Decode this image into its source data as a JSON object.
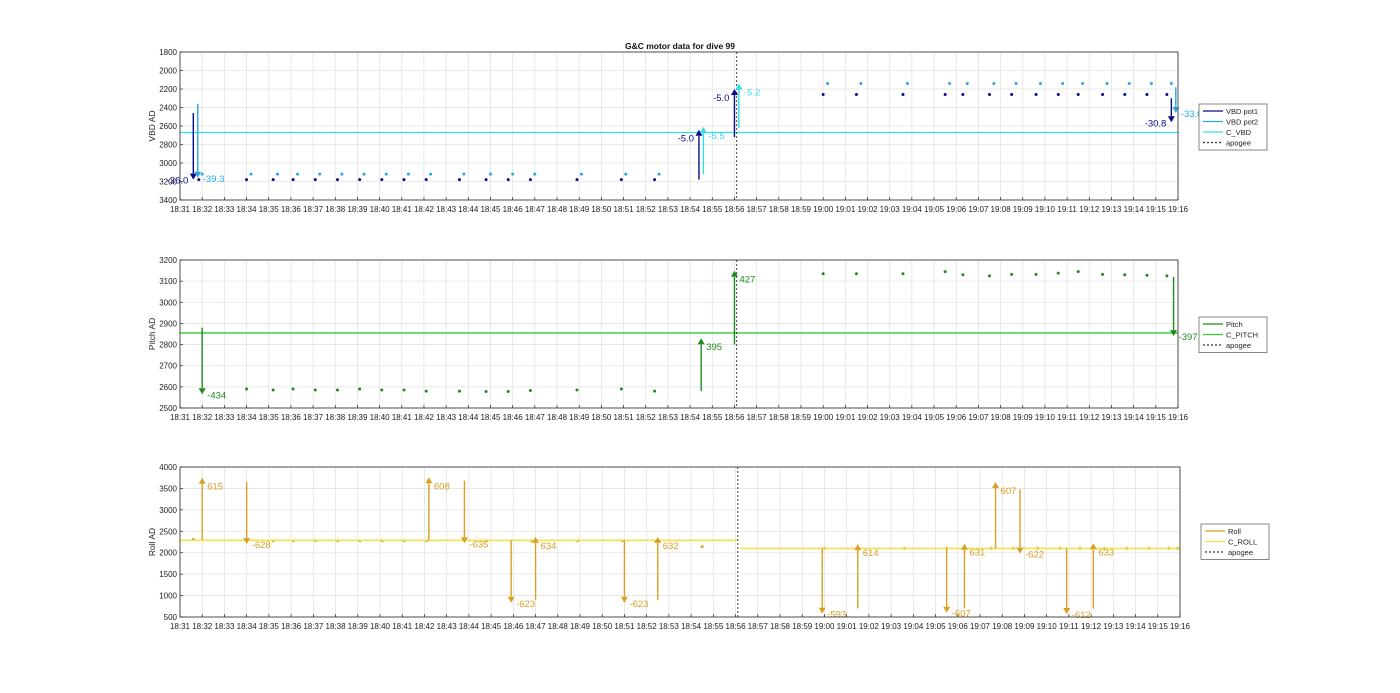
{
  "figure": {
    "title": "G&C motor data for dive 99"
  },
  "time_ticks": [
    "18:31",
    "18:32",
    "18:33",
    "18:34",
    "18:35",
    "18:36",
    "18:37",
    "18:38",
    "18:39",
    "18:40",
    "18:41",
    "18:42",
    "18:43",
    "18:44",
    "18:45",
    "18:46",
    "18:47",
    "18:48",
    "18:49",
    "18:50",
    "18:51",
    "18:52",
    "18:53",
    "18:54",
    "18:55",
    "18:56",
    "18:57",
    "18:58",
    "18:59",
    "19:00",
    "19:01",
    "19:02",
    "19:03",
    "19:04",
    "19:05",
    "19:06",
    "19:07",
    "19:08",
    "19:09",
    "19:10",
    "19:11",
    "19:12",
    "19:13",
    "19:14",
    "19:15",
    "19:16"
  ],
  "colors": {
    "vbd1": "#0a0a8c",
    "vbd2": "#2aa8e0",
    "c_vbd": "#33dde8",
    "pitch": "#1f8a1f",
    "c_pitch": "#33cc33",
    "roll": "#d9a024",
    "c_roll": "#f2e34a",
    "apogee": "#333333",
    "grid": "#e3e3e3",
    "axis": "#262626"
  },
  "chart_data": [
    {
      "type": "line",
      "title": "G&C motor data for dive 99",
      "xlabel": "",
      "ylabel": "VBD AD",
      "xlim": [
        "18:31",
        "19:16"
      ],
      "ylim": [
        3400,
        1800
      ],
      "y_reversed": true,
      "yticks": [
        1800,
        2000,
        2200,
        2400,
        2600,
        2800,
        3000,
        3200,
        3400
      ],
      "grid": true,
      "legend_location": "right",
      "series": [
        {
          "name": "VBD pot1",
          "key": "vbd1",
          "type": "scatter",
          "points": [
            [
              31.85,
              3180
            ],
            [
              34.0,
              3180
            ],
            [
              35.2,
              3180
            ],
            [
              36.1,
              3180
            ],
            [
              37.1,
              3180
            ],
            [
              38.1,
              3180
            ],
            [
              39.1,
              3180
            ],
            [
              40.1,
              3180
            ],
            [
              41.1,
              3180
            ],
            [
              42.1,
              3180
            ],
            [
              43.6,
              3180
            ],
            [
              44.8,
              3180
            ],
            [
              45.8,
              3180
            ],
            [
              46.8,
              3180
            ],
            [
              48.9,
              3180
            ],
            [
              50.9,
              3180
            ],
            [
              52.4,
              3180
            ],
            [
              60.0,
              2260
            ],
            [
              61.5,
              2260
            ],
            [
              63.6,
              2260
            ],
            [
              65.5,
              2260
            ],
            [
              66.3,
              2260
            ],
            [
              67.5,
              2260
            ],
            [
              68.5,
              2260
            ],
            [
              69.6,
              2260
            ],
            [
              70.6,
              2260
            ],
            [
              71.5,
              2260
            ],
            [
              72.6,
              2260
            ],
            [
              73.6,
              2260
            ],
            [
              74.6,
              2260
            ],
            [
              75.5,
              2260
            ]
          ]
        },
        {
          "name": "VBD pot2",
          "key": "vbd2",
          "type": "scatter",
          "points": [
            [
              32.0,
              3120
            ],
            [
              34.2,
              3120
            ],
            [
              35.4,
              3120
            ],
            [
              36.3,
              3120
            ],
            [
              37.3,
              3120
            ],
            [
              38.3,
              3120
            ],
            [
              39.3,
              3120
            ],
            [
              40.3,
              3120
            ],
            [
              41.3,
              3120
            ],
            [
              42.3,
              3120
            ],
            [
              43.8,
              3120
            ],
            [
              45.0,
              3120
            ],
            [
              46.0,
              3120
            ],
            [
              47.0,
              3120
            ],
            [
              49.1,
              3120
            ],
            [
              51.1,
              3120
            ],
            [
              52.6,
              3120
            ],
            [
              60.2,
              2140
            ],
            [
              61.7,
              2140
            ],
            [
              63.8,
              2140
            ],
            [
              65.7,
              2140
            ],
            [
              66.5,
              2140
            ],
            [
              67.7,
              2140
            ],
            [
              68.7,
              2140
            ],
            [
              69.8,
              2140
            ],
            [
              70.8,
              2140
            ],
            [
              71.7,
              2140
            ],
            [
              72.8,
              2140
            ],
            [
              73.8,
              2140
            ],
            [
              74.8,
              2140
            ],
            [
              75.7,
              2140
            ]
          ]
        },
        {
          "name": "C_VBD",
          "key": "c_vbd",
          "type": "hline",
          "y": 2670
        },
        {
          "name": "apogee",
          "key": "apogee",
          "type": "vline",
          "x": 56.1
        }
      ],
      "arrows": [
        {
          "x": 31.6,
          "y_from": 2460,
          "y_to": 3180,
          "label": "-36.0",
          "color_key": "vbd1",
          "label_side": "left"
        },
        {
          "x": 31.8,
          "y_from": 2360,
          "y_to": 3160,
          "label": "-39.3",
          "color_key": "vbd2",
          "label_side": "right"
        },
        {
          "x": 54.4,
          "y_from": 3180,
          "y_to": 2640,
          "label": "-5.0",
          "color_key": "vbd1",
          "label_side": "left"
        },
        {
          "x": 54.6,
          "y_from": 3120,
          "y_to": 2610,
          "label": "-5.5",
          "color_key": "c_vbd",
          "label_side": "right"
        },
        {
          "x": 56.0,
          "y_from": 2720,
          "y_to": 2200,
          "label": "-5.0",
          "color_key": "vbd1",
          "label_side": "left"
        },
        {
          "x": 56.2,
          "y_from": 2620,
          "y_to": 2140,
          "label": "-5.2",
          "color_key": "c_vbd",
          "label_side": "right"
        },
        {
          "x": 75.7,
          "y_from": 2300,
          "y_to": 2560,
          "label": "-30.8",
          "color_key": "vbd1",
          "label_side": "left"
        },
        {
          "x": 75.9,
          "y_from": 2180,
          "y_to": 2460,
          "label": "-33.0",
          "color_key": "vbd2",
          "label_side": "right"
        }
      ]
    },
    {
      "type": "line",
      "xlabel": "",
      "ylabel": "Pitch AD",
      "xlim": [
        "18:31",
        "19:16"
      ],
      "ylim": [
        2500,
        3200
      ],
      "yticks": [
        2500,
        2600,
        2700,
        2800,
        2900,
        3000,
        3100,
        3200
      ],
      "grid": true,
      "legend_location": "right",
      "series": [
        {
          "name": "Pitch",
          "key": "pitch",
          "type": "scatter",
          "points": [
            [
              34.0,
              2590
            ],
            [
              35.2,
              2585
            ],
            [
              36.1,
              2590
            ],
            [
              37.1,
              2585
            ],
            [
              38.1,
              2585
            ],
            [
              39.1,
              2590
            ],
            [
              40.1,
              2585
            ],
            [
              41.1,
              2585
            ],
            [
              42.1,
              2580
            ],
            [
              43.6,
              2580
            ],
            [
              44.8,
              2578
            ],
            [
              45.8,
              2578
            ],
            [
              46.8,
              2583
            ],
            [
              48.9,
              2585
            ],
            [
              50.9,
              2590
            ],
            [
              52.4,
              2580
            ],
            [
              60.0,
              3135
            ],
            [
              61.5,
              3135
            ],
            [
              63.6,
              3135
            ],
            [
              65.5,
              3145
            ],
            [
              66.3,
              3130
            ],
            [
              67.5,
              3125
            ],
            [
              68.5,
              3132
            ],
            [
              69.6,
              3132
            ],
            [
              70.6,
              3138
            ],
            [
              71.5,
              3145
            ],
            [
              72.6,
              3132
            ],
            [
              73.6,
              3130
            ],
            [
              74.6,
              3128
            ],
            [
              75.5,
              3125
            ]
          ]
        },
        {
          "name": "C_PITCH",
          "key": "c_pitch",
          "type": "hline",
          "y": 2855
        },
        {
          "name": "apogee",
          "key": "apogee",
          "type": "vline",
          "x": 56.1
        }
      ],
      "arrows": [
        {
          "x": 32.0,
          "y_from": 2880,
          "y_to": 2565,
          "label": "-434",
          "color_key": "pitch",
          "label_side": "right"
        },
        {
          "x": 54.5,
          "y_from": 2580,
          "y_to": 2830,
          "label": "395",
          "color_key": "pitch",
          "label_side": "right"
        },
        {
          "x": 56.0,
          "y_from": 2800,
          "y_to": 3150,
          "label": "427",
          "color_key": "pitch",
          "label_side": "right"
        },
        {
          "x": 75.8,
          "y_from": 3120,
          "y_to": 2840,
          "label": "-397",
          "color_key": "pitch",
          "label_side": "right"
        }
      ]
    },
    {
      "type": "line",
      "xlabel": "",
      "ylabel": "Roll AD",
      "xlim": [
        "18:31",
        "19:16"
      ],
      "ylim": [
        500,
        4000
      ],
      "yticks": [
        500,
        1000,
        1500,
        2000,
        2500,
        3000,
        3500,
        4000
      ],
      "grid": true,
      "legend_location": "right",
      "series": [
        {
          "name": "Roll",
          "key": "roll",
          "type": "scatter",
          "points": [
            [
              31.6,
              2310
            ],
            [
              34.0,
              2280
            ],
            [
              35.2,
              2280
            ],
            [
              36.1,
              2280
            ],
            [
              37.1,
              2280
            ],
            [
              38.1,
              2280
            ],
            [
              39.1,
              2280
            ],
            [
              40.1,
              2280
            ],
            [
              41.1,
              2280
            ],
            [
              42.1,
              2280
            ],
            [
              44.8,
              2280
            ],
            [
              46.8,
              2280
            ],
            [
              48.9,
              2280
            ],
            [
              50.9,
              2280
            ],
            [
              52.4,
              2280
            ],
            [
              54.5,
              2140
            ],
            [
              60.0,
              2100
            ],
            [
              61.5,
              2100
            ],
            [
              63.6,
              2100
            ],
            [
              65.5,
              2100
            ],
            [
              66.3,
              2100
            ],
            [
              67.5,
              2100
            ],
            [
              68.5,
              2100
            ],
            [
              69.6,
              2100
            ],
            [
              70.6,
              2100
            ],
            [
              71.5,
              2100
            ],
            [
              72.6,
              2100
            ],
            [
              73.6,
              2100
            ],
            [
              74.6,
              2100
            ],
            [
              75.5,
              2100
            ],
            [
              75.9,
              2100
            ]
          ]
        },
        {
          "name": "C_ROLL",
          "key": "c_roll",
          "type": "segments",
          "segments": [
            [
              31.0,
              56.1,
              2290
            ],
            [
              56.2,
              76.0,
              2100
            ]
          ]
        },
        {
          "name": "apogee",
          "key": "apogee",
          "type": "vline",
          "x": 56.1
        }
      ],
      "arrows": [
        {
          "x": 32.0,
          "y_from": 2300,
          "y_to": 3750,
          "label": "615",
          "color_key": "roll",
          "label_side": "right"
        },
        {
          "x": 34.0,
          "y_from": 3650,
          "y_to": 2200,
          "label": "-628",
          "color_key": "roll",
          "label_side": "right"
        },
        {
          "x": 42.2,
          "y_from": 2290,
          "y_to": 3760,
          "label": "608",
          "color_key": "roll",
          "label_side": "right"
        },
        {
          "x": 43.8,
          "y_from": 3680,
          "y_to": 2220,
          "label": "-635",
          "color_key": "roll",
          "label_side": "right"
        },
        {
          "x": 45.9,
          "y_from": 2290,
          "y_to": 830,
          "label": "-623",
          "color_key": "roll",
          "label_side": "right"
        },
        {
          "x": 47.0,
          "y_from": 900,
          "y_to": 2370,
          "label": "634",
          "color_key": "roll",
          "label_side": "right"
        },
        {
          "x": 51.0,
          "y_from": 2290,
          "y_to": 830,
          "label": "-623",
          "color_key": "roll",
          "label_side": "right"
        },
        {
          "x": 52.5,
          "y_from": 900,
          "y_to": 2370,
          "label": "632",
          "color_key": "roll",
          "label_side": "right"
        },
        {
          "x": 59.9,
          "y_from": 2100,
          "y_to": 580,
          "label": "-593",
          "color_key": "roll",
          "label_side": "right"
        },
        {
          "x": 61.5,
          "y_from": 700,
          "y_to": 2200,
          "label": "614",
          "color_key": "roll",
          "label_side": "right"
        },
        {
          "x": 65.5,
          "y_from": 2100,
          "y_to": 600,
          "label": "-607",
          "color_key": "roll",
          "label_side": "right"
        },
        {
          "x": 66.3,
          "y_from": 700,
          "y_to": 2210,
          "label": "631",
          "color_key": "roll",
          "label_side": "right"
        },
        {
          "x": 67.7,
          "y_from": 2100,
          "y_to": 3650,
          "label": "607",
          "color_key": "roll",
          "label_side": "right"
        },
        {
          "x": 68.8,
          "y_from": 3480,
          "y_to": 1980,
          "label": "-622",
          "color_key": "roll",
          "label_side": "right"
        },
        {
          "x": 70.9,
          "y_from": 2100,
          "y_to": 570,
          "label": "-612",
          "color_key": "roll",
          "label_side": "right"
        },
        {
          "x": 72.1,
          "y_from": 700,
          "y_to": 2220,
          "label": "633",
          "color_key": "roll",
          "label_side": "right"
        }
      ]
    }
  ]
}
